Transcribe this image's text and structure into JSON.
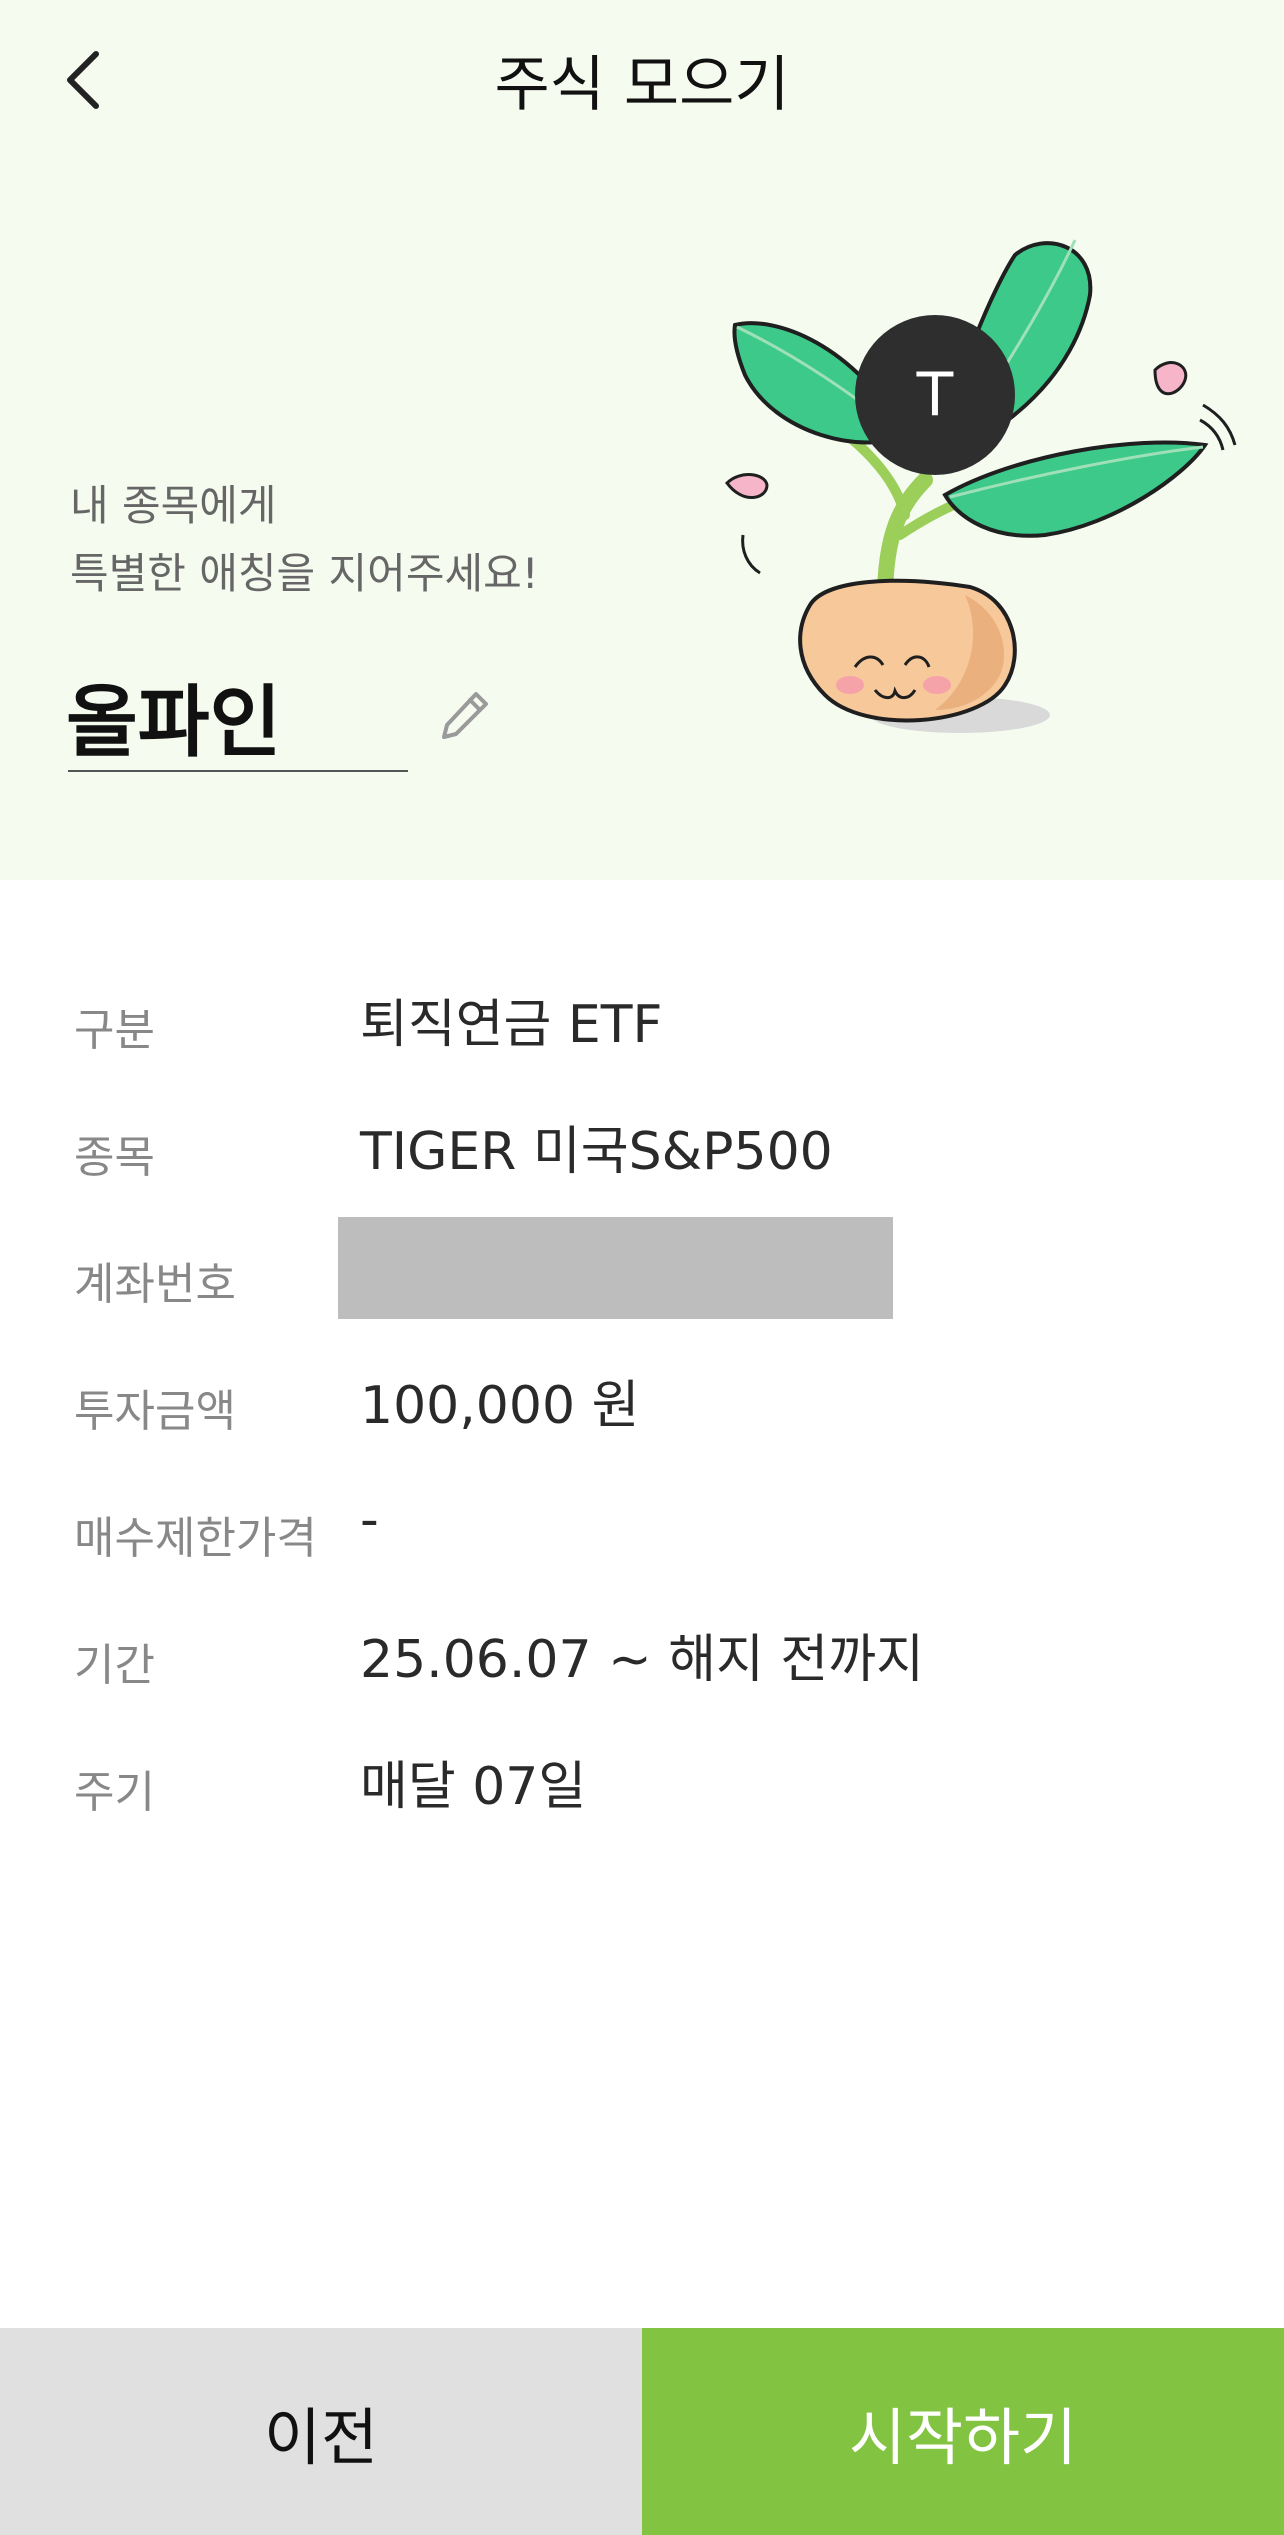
{
  "header": {
    "title": "주식 모으기",
    "back_icon": "chevron-left-icon"
  },
  "hero": {
    "prompt_line1": "내 종목에게",
    "prompt_line2": "특별한 애칭을 지어주세요!",
    "nickname": "올파인",
    "edit_icon": "pencil-icon",
    "avatar_letter": "T"
  },
  "details": [
    {
      "label": "구분",
      "value": "퇴직연금 ETF"
    },
    {
      "label": "종목",
      "value": "TIGER 미국S&P500"
    },
    {
      "label": "계좌번호",
      "value": ""
    },
    {
      "label": "투자금액",
      "value": "100,000 원"
    },
    {
      "label": "매수제한가격",
      "value": "-"
    },
    {
      "label": "기간",
      "value": "25.06.07 ~ 해지 전까지"
    },
    {
      "label": "주기",
      "value": "매달 07일"
    }
  ],
  "footer": {
    "prev_label": "이전",
    "start_label": "시작하기"
  },
  "colors": {
    "hero_bg": "#f6fbf0",
    "accent": "#82c341",
    "secondary_btn": "#e0e0e0"
  }
}
